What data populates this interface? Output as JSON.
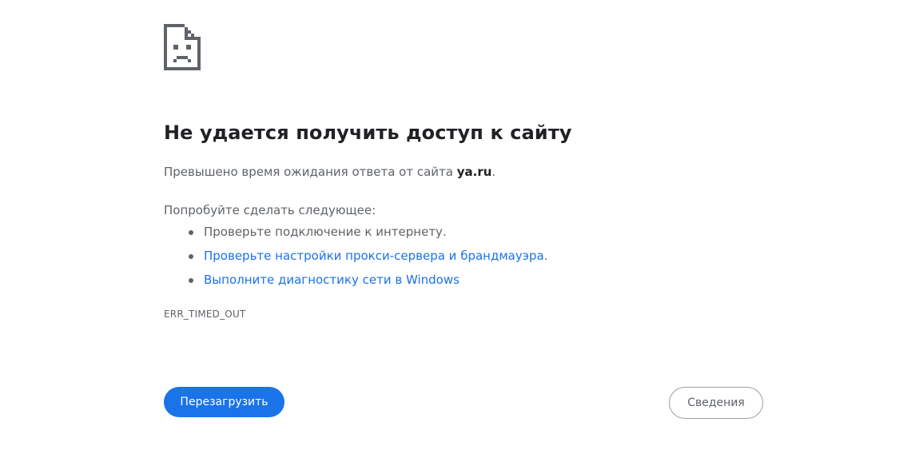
{
  "error_page": {
    "icon": "sad-document-icon",
    "title": "Не удается получить доступ к сайту",
    "message_before": "Превышено время ожидания ответа от сайта ",
    "site": "ya.ru",
    "message_after": ".",
    "suggest_intro": "Попробуйте сделать следующее:",
    "suggestions": [
      {
        "text": "Проверьте подключение к интернету.",
        "link": false
      },
      {
        "text": "Проверьте настройки прокси-сервера и брандмауэра",
        "suffix": ".",
        "link": true
      },
      {
        "text": "Выполните диагностику сети в Windows",
        "link": true
      }
    ],
    "error_code": "ERR_TIMED_OUT",
    "reload_label": "Перезагрузить",
    "details_label": "Сведения"
  },
  "colors": {
    "accent": "#1a73e8",
    "text_primary": "#202124",
    "text_secondary": "#5f6368",
    "icon": "#5f6368"
  }
}
